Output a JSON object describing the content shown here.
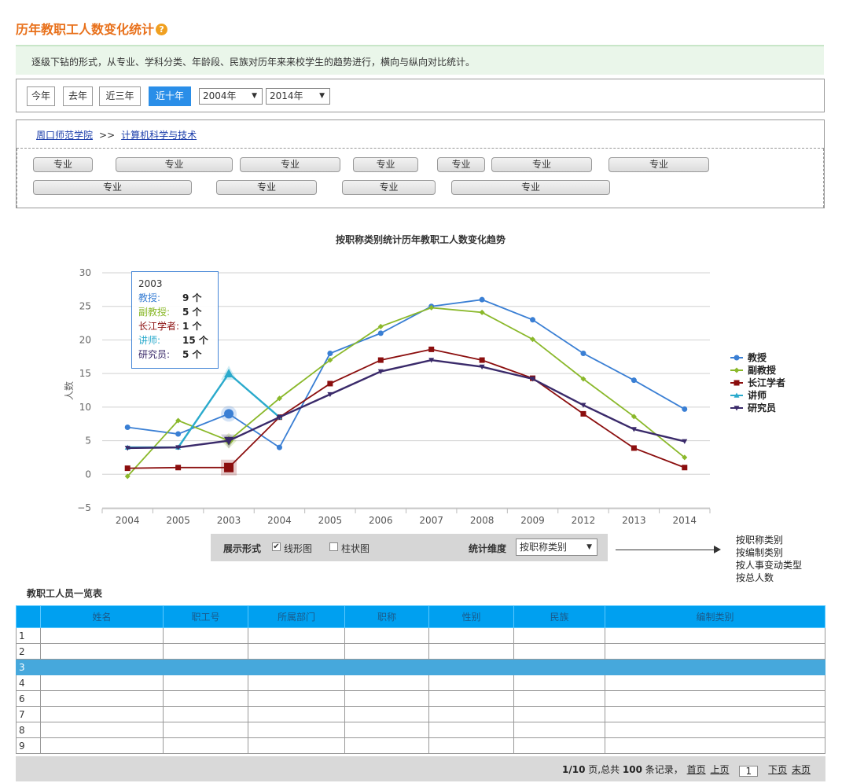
{
  "header": {
    "title": "历年教职工人数变化统计",
    "help_icon": "?"
  },
  "description": "逐级下钻的形式，从专业、学科分类、年龄段、民族对历年来来校学生的趋势进行，横向与纵向对比统计。",
  "filter": {
    "buttons": [
      "今年",
      "去年",
      "近三年",
      "近十年"
    ],
    "active": "近十年",
    "from_year": "2004年",
    "to_year": "2014年"
  },
  "breadcrumb": {
    "root": "周口师范学院",
    "sep": ">>",
    "current": "计算机科学与技术"
  },
  "majors": [
    "专业",
    "专业",
    "专业",
    "专业",
    "专业",
    "专业",
    "专业",
    "专业",
    "专业",
    "专业",
    "专业"
  ],
  "chart_data": {
    "type": "line",
    "title": "按职称类别统计历年教职工人数变化趋势",
    "ylabel": "人数",
    "ylim": [
      -5,
      30
    ],
    "yticks": [
      "30",
      "25",
      "20",
      "15",
      "10",
      "5",
      "0",
      "−5"
    ],
    "categories": [
      "2004",
      "2005",
      "2003",
      "2004",
      "2005",
      "2006",
      "2007",
      "2008",
      "2009",
      "2012",
      "2013",
      "2014"
    ],
    "series": [
      {
        "name": "教授",
        "color": "#3a7fd4",
        "marker": "circle",
        "values": [
          7,
          6,
          9,
          4,
          18,
          21,
          25,
          26,
          23,
          18,
          14,
          9.7
        ]
      },
      {
        "name": "副教授",
        "color": "#8ab82a",
        "marker": "diamond",
        "values": [
          -0.3,
          8,
          5,
          11.3,
          17,
          22,
          24.8,
          24.1,
          20.1,
          14.2,
          8.6,
          2.5
        ]
      },
      {
        "name": "长江学者",
        "color": "#8b0e0e",
        "marker": "square",
        "values": [
          0.9,
          1,
          1,
          8.5,
          13.5,
          17,
          18.6,
          17,
          14.3,
          9,
          3.9,
          1
        ]
      },
      {
        "name": "讲师",
        "color": "#2aaacc",
        "marker": "triangle",
        "values": [
          4,
          4,
          15,
          8.5
        ]
      },
      {
        "name": "研究员",
        "color": "#3a2a6a",
        "marker": "tridown",
        "values": [
          3.9,
          4,
          5,
          8.5,
          11.9,
          15.3,
          17,
          16,
          14.2,
          10.3,
          6.7,
          4.9
        ]
      }
    ],
    "legend_position": "right",
    "grid": true,
    "tooltip": {
      "title": "2003",
      "rows": [
        {
          "label": "教授:",
          "value": "9 个",
          "color": "#3a7fd4"
        },
        {
          "label": "副教授:",
          "value": "5 个",
          "color": "#8ab82a"
        },
        {
          "label": "长江学者:",
          "value": "1 个",
          "color": "#8b0e0e"
        },
        {
          "label": "讲师:",
          "value": "15 个",
          "color": "#2aaacc"
        },
        {
          "label": "研究员:",
          "value": "5 个",
          "color": "#3a2a6a"
        }
      ]
    }
  },
  "controls": {
    "display_label": "展示形式",
    "line_label": "线形图",
    "bar_label": "柱状图",
    "line_checked": "✔",
    "dimension_label": "统计维度",
    "dimension_value": "按职称类别",
    "dimension_options": [
      "按职称类别",
      "按编制类别",
      "按人事变动类型",
      "按总人数"
    ]
  },
  "table": {
    "title": "教职工人员一览表",
    "headers": [
      "",
      "姓名",
      "职工号",
      "所属部门",
      "职称",
      "性别",
      "民族",
      "编制类别"
    ],
    "row_numbers": [
      "1",
      "2",
      "3",
      "4",
      "6",
      "7",
      "8",
      "9"
    ],
    "highlight_row": "3"
  },
  "pager": {
    "summary_pre": "1/10",
    "summary_mid": " 页,总共 ",
    "total": "100",
    "summary_post": " 条记录，",
    "first": "首页",
    "prev": "上页",
    "page": "1",
    "next": "下页",
    "last": "末页"
  }
}
